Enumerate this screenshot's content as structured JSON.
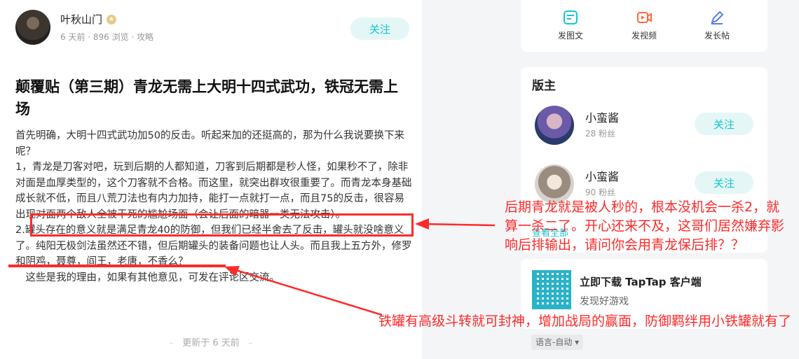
{
  "author": {
    "name": "叶秋山门",
    "meta": "6 天前 · 896 浏览 · 攻略",
    "follow_label": "关注"
  },
  "post": {
    "title": "颠覆贴（第三期）青龙无需上大明十四式武功，铁冠无需上场",
    "paragraphs": [
      "首先明确，大明十四式武功加50的反击。听起来加的还挺高的，那为什么我说要换下来呢？",
      "1，青龙是刀客对吧，玩到后期的人都知道，刀客到后期都是秒人怪，如果秒不了，除非对面是血厚类型的，这个刀客就不合格。而这里，就突出群攻很重要了。而青龙本身基础成长就不低，而且八荒刀法也有内力加持，能打一点就打一点，而且75的反击，很容易出现对面两个敌人全被干死的尴尬场面（会让后面的暗器一类无法攻击）。",
      "2.罐头存在的意义就是满足青龙40的防御，但我们已经半舍去了反击，罐头就没啥意义了。纯阳无极剑法虽然还不错，但后期罐头的装备问题也让人头。而且我上五方外，修罗和阴鸡，聂尊，阎王，老唐，不香么？",
      "　这些是我的理由，如果有其他意见，可发在评论区交流。"
    ],
    "updated": "更新于 6 天前"
  },
  "actions": {
    "image_post": "发图文",
    "video_post": "发视频",
    "long_post": "发长帖"
  },
  "moderators": {
    "title": "版主",
    "items": [
      {
        "name": "小蛮酱",
        "fans": "28 粉丝",
        "follow_label": "关注"
      },
      {
        "name": "小蛮酱",
        "fans": "90 粉丝",
        "follow_label": "关注"
      }
    ],
    "see_all": "查看全部"
  },
  "download": {
    "title": "立即下载 TapTap 客户端",
    "subtitle": "发现好游戏"
  },
  "language": "语言-自动 ▾",
  "annotations": {
    "note1": "后期青龙就是被人秒的，根本没机会一杀2，就算一杀二了。开心还来不及，这哥们居然嫌弃影响后排输出，请问你会用青龙保后排？？",
    "note2": "铁罐有高级斗转就可封神，增加战局的赢面，防御羁绊用小铁罐就有了"
  },
  "colors": {
    "accent": "#15c5ce",
    "follow_bg": "#e4f7f6",
    "annotation": "#ff2a2a",
    "action_icons": "#ff6a3d"
  }
}
